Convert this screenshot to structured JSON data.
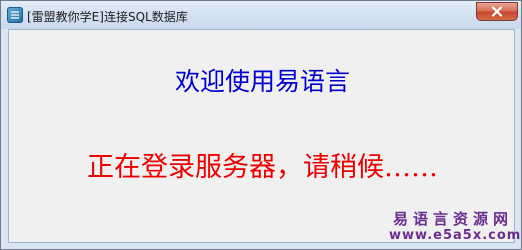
{
  "window": {
    "title": "[雷盟教你学E]连接SQL数据库"
  },
  "content": {
    "welcome_text": "欢迎使用易语言",
    "status_text": "正在登录服务器，请稍候……"
  },
  "watermark": {
    "name": "易语言资源网",
    "url": "www.e5a5x.com"
  },
  "colors": {
    "welcome": "#0000cc",
    "status": "#ee0000",
    "watermark": "#6a2f8e",
    "close_button": "#c6472c"
  },
  "icons": {
    "app": "app-icon",
    "close": "close-icon"
  }
}
